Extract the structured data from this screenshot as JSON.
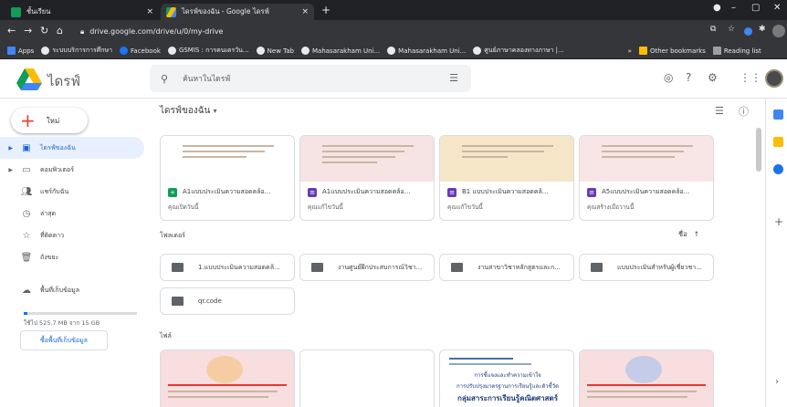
{
  "tabs": [
    {
      "label": "ชั้นเรียน",
      "close": "×",
      "favicon_color": "#0f9d58"
    },
    {
      "label": "ไดรฟ์ของฉัน - Google ไดรฟ์",
      "close": "×",
      "favicon_color": "#fbbc04"
    }
  ],
  "new_tab": "+",
  "window": {
    "controls": [
      "–",
      "▢",
      "✕"
    ]
  },
  "address": {
    "url": "drive.google.com/drive/u/0/my-drive"
  },
  "bookmarks": {
    "items": [
      "Apps",
      "ระบบบริการการศึกษา",
      "Facebook",
      "GSMIS : การคนเดรวัน...",
      "New Tab",
      "Mahasarakham Uni...",
      "Mahasarakham Uni...",
      "ศูนย์ภาษาคลองทางภาษา |..."
    ],
    "more": "»",
    "other": "Other bookmarks",
    "reading": "Reading list"
  },
  "header": {
    "app_name": "ไดรฟ์",
    "search_placeholder": "ค้นหาในไดรฟ์"
  },
  "sidebar": {
    "new_label": "ใหม่",
    "items": [
      {
        "label": "ไดรฟ์ของฉัน",
        "icon": "my-drive-icon"
      },
      {
        "label": "คอมพิวเตอร์",
        "icon": "computer-icon"
      },
      {
        "label": "แชร์กับฉัน",
        "icon": "shared-icon"
      },
      {
        "label": "ล่าสุด",
        "icon": "clock-icon"
      },
      {
        "label": "ที่ติดดาว",
        "icon": "star-icon"
      },
      {
        "label": "ถังขยะ",
        "icon": "trash-icon"
      }
    ],
    "storage_label": "พื้นที่เก็บข้อมูล",
    "storage_used": "ใช้ไป 525.7 MB จาก 15 GB",
    "storage_fraction": 0.034,
    "buy_storage": "ซื้อพื้นที่เก็บข้อมูล"
  },
  "main": {
    "title": "ไดรฟ์ของฉัน",
    "suggested": [
      {
        "name": "A1แบบประเมินความสอดคล้อ...",
        "sub": "คุณเปิดวันนี้",
        "type": "sheets",
        "thumb": "#ffffff"
      },
      {
        "name": "A1แบบประเมินความสอดคล้อ...",
        "sub": "คุณแก้ไขวันนี้",
        "type": "forms",
        "thumb": "#f6e3e3"
      },
      {
        "name": "B1 แบบประเมินความสอดคล้...",
        "sub": "คุณแก้ไขวันนี้",
        "type": "forms",
        "thumb": "#f5e6c8"
      },
      {
        "name": "A5แบบประเมินความสอดคล้อ...",
        "sub": "คุณสร้างเมื่อวานนี้",
        "type": "forms",
        "thumb": "#f8e6e6"
      }
    ],
    "folders_label": "โฟลเดอร์",
    "sort_label": "ชื่อ",
    "sort_arrow": "↑",
    "folders": [
      "1.แบบประเมินความสอดคล้...",
      "งานศูนย์ฝึกประสบการณ์วิชา...",
      "งานสาขาวิชาหลักสูตรและก...",
      "แบบประเมินสำหรับผู้เชี่ยวชา...",
      "qr.code"
    ],
    "files_label": "ไฟล์",
    "file_preview_text": [
      "การชี้แจงและทำความเข้าใจ",
      "การปรับปรุงมาตรฐานการเรียนรู้และตัวชี้วัด",
      "กลุ่มสาระการเรียนรู้คณิตศาสตร์"
    ]
  },
  "colors": {
    "accent": "#1a73e8",
    "active_bg": "#e8f0fe",
    "sheets": "#0f9d58",
    "forms": "#673ab7"
  }
}
